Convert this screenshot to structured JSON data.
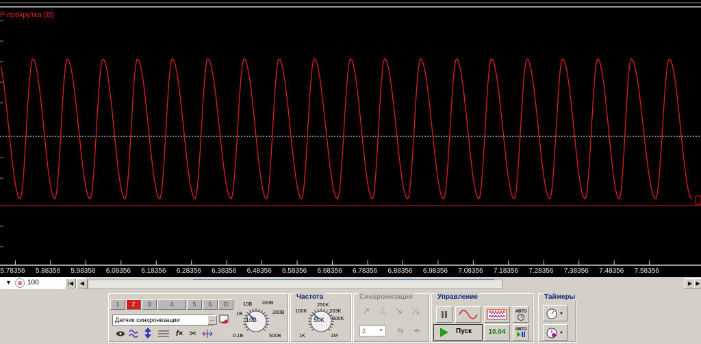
{
  "channel": {
    "label": "P прокрутка (В)",
    "color": "#e02020"
  },
  "time_axis": {
    "ticks": [
      "5.78356",
      "5.88356",
      "5.98356",
      "6.08356",
      "6.18356",
      "6.28356",
      "6.38356",
      "6.48356",
      "6.58356",
      "6.68356",
      "6.78356",
      "6.88356",
      "6.98356",
      "7.08356",
      "7.18356",
      "7.28356",
      "7.38356",
      "7.48356",
      "7.58356"
    ]
  },
  "zoom": {
    "value": "100"
  },
  "channels": {
    "buttons": [
      "1",
      "2",
      "3",
      "4",
      "5",
      "6",
      "D"
    ],
    "active": "2",
    "sensor_select": "Датчик синхронизации",
    "more_label": "..."
  },
  "voltage": {
    "knob_value": "10В",
    "scale": [
      "1В",
      "10В",
      "100В",
      "200В",
      "500В",
      "0.1В"
    ]
  },
  "frequency": {
    "title": "Частота",
    "knob_value": "50K",
    "scale": [
      "100K",
      "250K",
      "333K",
      "500K",
      "1M",
      "1K"
    ]
  },
  "sync": {
    "title": "Синхронизация",
    "select_value": "2"
  },
  "control": {
    "title": "Управление",
    "start_label": "Пуск",
    "time_value": "10.04",
    "auto_label": "АВТО"
  },
  "timers": {
    "title": "Таймеры"
  },
  "chart_data": {
    "type": "line",
    "x_label_ticks": [
      "5.78356",
      "5.88356",
      "5.98356",
      "6.08356",
      "6.18356",
      "6.28356",
      "6.38356",
      "6.48356",
      "6.58356",
      "6.68356",
      "6.78356",
      "6.88356",
      "6.98356",
      "7.08356",
      "7.18356",
      "7.28356",
      "7.38356",
      "7.48356",
      "7.58356"
    ],
    "xlim": [
      5.74,
      7.73
    ],
    "peak_times": [
      5.733,
      5.833,
      5.931,
      6.032,
      6.13,
      6.229,
      6.33,
      6.433,
      6.532,
      6.632,
      6.735,
      6.832,
      6.934,
      7.036,
      7.135,
      7.236,
      7.337,
      7.437,
      7.532,
      7.64
    ],
    "peak_level": 1.0,
    "trough_level": 0.0,
    "period": 0.1,
    "series": [
      {
        "color": "#e02020"
      }
    ],
    "grid": true
  }
}
